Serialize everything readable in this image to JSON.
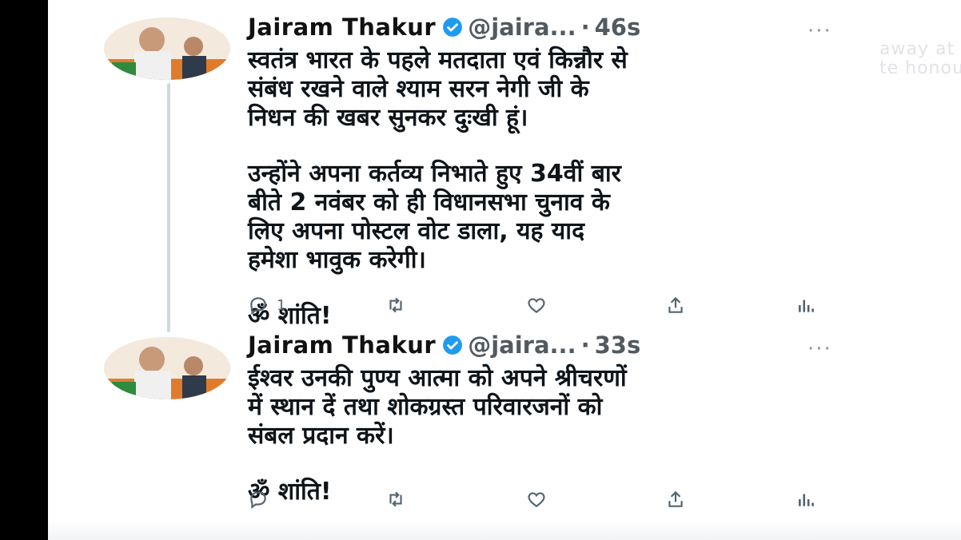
{
  "background_bleed": [
    "away at h",
    "te honour"
  ],
  "tweets": [
    {
      "author": "Jairam Thakur",
      "handle": "@jaira...",
      "dot": "·",
      "time": "46s",
      "more": "···",
      "paragraphs": [
        "स्वतंत्र भारत के पहले मतदाता एवं किन्नौर से\nसंबंध रखने वाले श्याम सरन नेगी जी के\nनिधन की खबर सुनकर दुःखी हूं।",
        "उन्होंने अपना कर्तव्य निभाते हुए 34वीं बार\nबीते 2 नवंबर को ही विधानसभा चुनाव के\nलिए अपना पोस्टल वोट डाला, यह याद\nहमेशा भावुक करेगी।",
        "ॐ शांति!"
      ],
      "reply_count": "1"
    },
    {
      "author": "Jairam Thakur",
      "handle": "@jaira...",
      "dot": "·",
      "time": "33s",
      "more": "···",
      "paragraphs": [
        "ईश्वर उनकी पुण्य आत्मा को अपने श्रीचरणों\nमें स्थान दें तथा शोकग्रस्त परिवारजनों को\nसंबल प्रदान करें।",
        "ॐ शांति!"
      ],
      "reply_count": ""
    }
  ],
  "icons": [
    "reply-icon",
    "retweet-icon",
    "like-icon",
    "share-icon",
    "analytics-icon",
    "verified-icon"
  ],
  "colors": {
    "verified": "#1d9bf0",
    "icon_gray": "#536471",
    "thread_line": "#cfd9de"
  }
}
